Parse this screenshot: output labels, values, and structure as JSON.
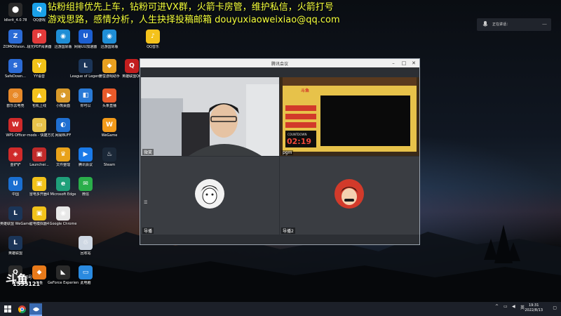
{
  "banner": {
    "line1": "钻粉组排优先上车，钻粉可进VX群，火箭卡房管，维护私信，火箭打号",
    "line2": "游戏思路，感情分析，人生抉择投稿邮箱 douyuxiaoweixiao@qq.com"
  },
  "desktop_icons": [
    {
      "label": "Idlerit_4.0.78",
      "color": "#2a2a2a",
      "glyph": "⬤"
    },
    {
      "label": "QQ游戏",
      "color": "#1aa0e8",
      "glyph": "Q"
    },
    {
      "label": "ZOMOVision...",
      "color": "#2b6bd6",
      "glyph": "Z"
    },
    {
      "label": "极光PDF阅读器",
      "color": "#e23a3a",
      "glyph": "P"
    },
    {
      "label": "迅游国际版",
      "color": "#1f8ed6",
      "glyph": "◉"
    },
    {
      "label": "网易UU加速器",
      "color": "#1c5fd1",
      "glyph": "U"
    },
    {
      "label": "迅游国际版",
      "color": "#1f8ed6",
      "glyph": "◉"
    },
    {
      "label": "QQ音乐",
      "color": "#f4c21c",
      "glyph": "♪"
    },
    {
      "label": "SafeDown...",
      "color": "#2b6bd6",
      "glyph": "S"
    },
    {
      "label": "YY语音",
      "color": "#f2c318",
      "glyph": "Y"
    },
    {
      "label": "League of Legends",
      "color": "#1b3558",
      "glyph": "L"
    },
    {
      "label": "野蛮游戏助手",
      "color": "#e8a020",
      "glyph": "◆"
    },
    {
      "label": "英雄联盟QQ",
      "color": "#c21e1e",
      "glyph": "Q"
    },
    {
      "label": "欧乐云电竞",
      "color": "#e88a2a",
      "glyph": "◎"
    },
    {
      "label": "包机上线",
      "color": "#f4c21c",
      "glyph": "▲"
    },
    {
      "label": "小熊桌面",
      "color": "#d99a2a",
      "glyph": "◕"
    },
    {
      "label": "你可以",
      "color": "#2a7ad6",
      "glyph": "◧"
    },
    {
      "label": "头条直播",
      "color": "#e85a2a",
      "glyph": "▶"
    },
    {
      "label": "WPS Office",
      "color": "#d02a2a",
      "glyph": "W"
    },
    {
      "label": "~mods - 快捷方式",
      "color": "#e8c24a",
      "glyph": "▭"
    },
    {
      "label": "网易BUFF",
      "color": "#1f6fd1",
      "glyph": "◐"
    },
    {
      "label": "WeGame",
      "color": "#f29a1a",
      "glyph": "W"
    },
    {
      "label": "金铲铲",
      "color": "#d02a2a",
      "glyph": "◈"
    },
    {
      "label": "Launcher...",
      "color": "#c02a2a",
      "glyph": "▣"
    },
    {
      "label": "文件整理",
      "color": "#e8a21a",
      "glyph": "♛"
    },
    {
      "label": "腾讯会议",
      "color": "#1a7ae8",
      "glyph": "▶"
    },
    {
      "label": "Steam",
      "color": "#1b2838",
      "glyph": "♨"
    },
    {
      "label": "中国",
      "color": "#1a6fd1",
      "glyph": "U"
    },
    {
      "label": "雷电多开器4",
      "color": "#f2c21a",
      "glyph": "▣"
    },
    {
      "label": "Microsoft Edge",
      "color": "#1fa07a",
      "glyph": "e"
    },
    {
      "label": "微信",
      "color": "#2aae4a",
      "glyph": "✉"
    },
    {
      "label": "英雄联盟 WeGame版",
      "color": "#1b3558",
      "glyph": "L"
    },
    {
      "label": "雷电模拟器4",
      "color": "#f2c21a",
      "glyph": "▣"
    },
    {
      "label": "Google Chrome",
      "color": "#e8e8e8",
      "glyph": "◉"
    },
    {
      "label": "英雄联盟",
      "color": "#1b3558",
      "glyph": "L"
    },
    {
      "label": "回收站",
      "color": "#cfd8e3",
      "glyph": "♲"
    },
    {
      "label": "YY",
      "color": "#2a2a2a",
      "glyph": "Q"
    },
    {
      "label": "斗鱼",
      "color": "#e87a1a",
      "glyph": "◆"
    },
    {
      "label": "GeForce Experience",
      "color": "#2a2a2a",
      "glyph": "◣"
    },
    {
      "label": "此电脑",
      "color": "#2a8ae0",
      "glyph": "▭"
    }
  ],
  "window": {
    "title": "腾讯会议",
    "minimize": "–",
    "maximize": "□",
    "close": "✕",
    "tiles": [
      {
        "name": "微笑"
      },
      {
        "name": "pgm"
      },
      {
        "name": "导播"
      },
      {
        "name": "导播2"
      }
    ],
    "stream": {
      "brand": "斗鱼",
      "timer": "02:19",
      "countdown": "COUNTDOWN"
    }
  },
  "notification": {
    "text": "正在讲话："
  },
  "watermark": {
    "logo": "斗鱼",
    "sub": "房间号",
    "room": "1535121"
  },
  "taskbar": {
    "start_icon": "windows-icon",
    "tray_chevron": "^",
    "tray_lang": "英",
    "time": "19:31",
    "date": "2022/8/13"
  }
}
